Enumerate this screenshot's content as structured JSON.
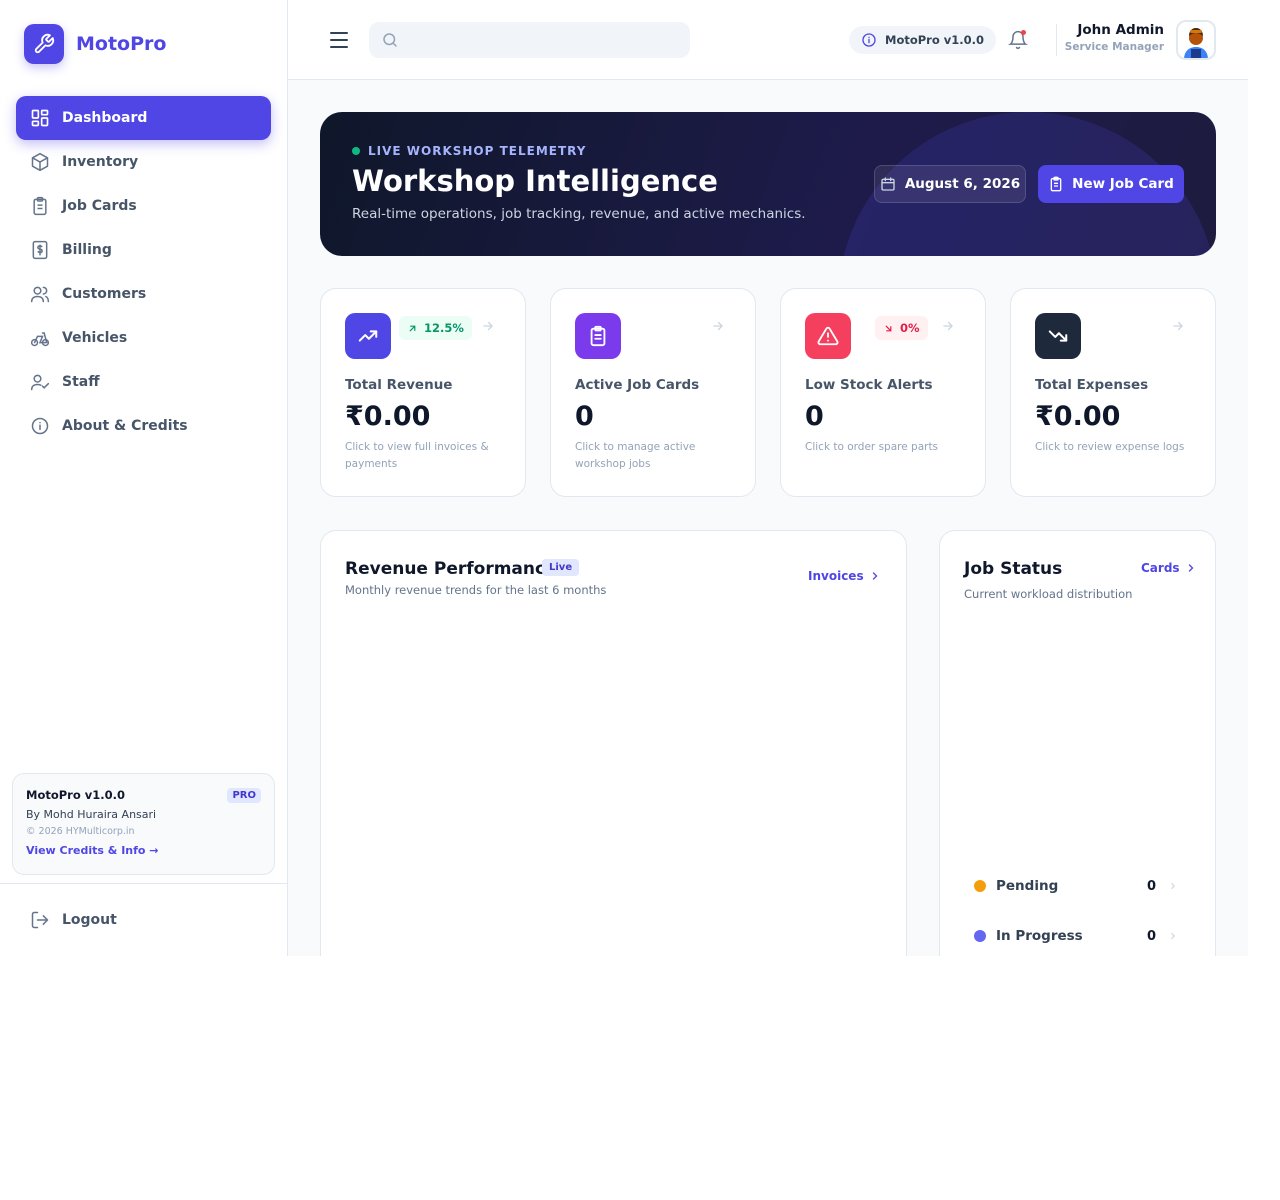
{
  "brand": {
    "name": "MotoPro",
    "logo_icon": "wrench-icon",
    "accent": "#4f46e5"
  },
  "sidebar": {
    "items": [
      {
        "label": "Dashboard",
        "icon": "dashboard-grid-icon",
        "active": true
      },
      {
        "label": "Inventory",
        "icon": "package-icon",
        "active": false
      },
      {
        "label": "Job Cards",
        "icon": "clipboard-icon",
        "active": false
      },
      {
        "label": "Billing",
        "icon": "dollar-receipt-icon",
        "active": false
      },
      {
        "label": "Customers",
        "icon": "users-icon",
        "active": false
      },
      {
        "label": "Vehicles",
        "icon": "bike-icon",
        "active": false
      },
      {
        "label": "Staff",
        "icon": "user-check-icon",
        "active": false
      },
      {
        "label": "About & Credits",
        "icon": "info-icon",
        "active": false
      }
    ],
    "credits": {
      "title": "MotoPro v1.0.0",
      "badge": "PRO",
      "author": "By Mohd Huraira Ansari",
      "copyright": "© 2026 HYMulticorp.in",
      "link": "View Credits & Info →"
    },
    "logout": "Logout"
  },
  "topbar": {
    "search_placeholder": "",
    "search_value": "",
    "version": "MotoPro v1.0.0",
    "user": {
      "name": "John Admin",
      "role": "Service Manager"
    }
  },
  "hero": {
    "tag": "LIVE WORKSHOP TELEMETRY",
    "title": "Workshop Intelligence",
    "subtitle": "Real-time operations, job tracking, revenue, and active mechanics.",
    "date": "August 6, 2026",
    "new_job": "New Job Card"
  },
  "stats": [
    {
      "label": "Total Revenue",
      "value": "₹0.00",
      "desc": "Click to view full invoices & payments",
      "badge": "12.5%",
      "badge_dir": "up",
      "color": "#4f46e5",
      "icon": "trending-up-icon"
    },
    {
      "label": "Active Job Cards",
      "value": "0",
      "desc": "Click to manage active workshop jobs",
      "badge": "",
      "color": "#7c3aed",
      "icon": "clipboard-list-icon"
    },
    {
      "label": "Low Stock Alerts",
      "value": "0",
      "desc": "Click to order spare parts",
      "badge": "0%",
      "badge_dir": "down",
      "color": "#f43f5e",
      "icon": "alert-triangle-icon"
    },
    {
      "label": "Total Expenses",
      "value": "₹0.00",
      "desc": "Click to review expense logs",
      "badge": "",
      "color": "#1e293b",
      "icon": "trending-down-icon"
    }
  ],
  "revenue_panel": {
    "title": "Revenue Performance",
    "badge": "Live",
    "subtitle": "Monthly revenue trends for the last 6 months",
    "link": "Invoices"
  },
  "job_status_panel": {
    "title": "Job Status",
    "subtitle": "Current workload distribution",
    "link": "Cards",
    "rows": [
      {
        "label": "Pending",
        "count": "0",
        "color": "#f59e0b"
      },
      {
        "label": "In Progress",
        "count": "0",
        "color": "#6366f1"
      }
    ]
  }
}
